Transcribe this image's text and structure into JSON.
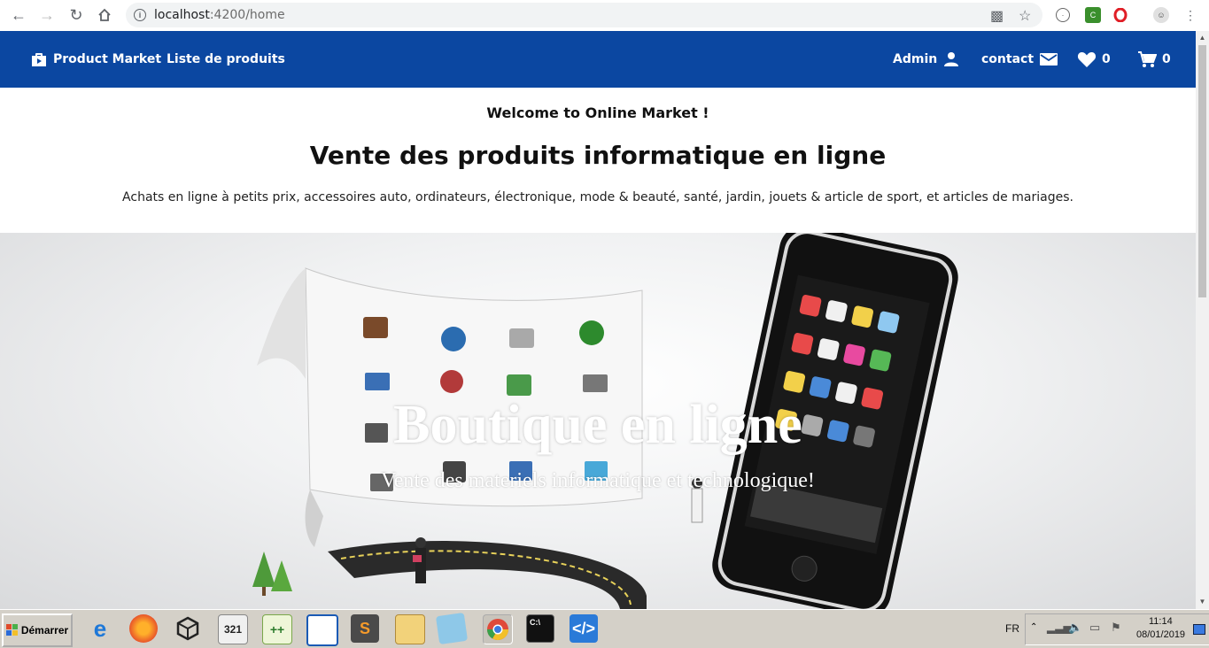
{
  "browser": {
    "url_host": "localhost",
    "url_rest": ":4200/home"
  },
  "nav": {
    "brand": "Product Market",
    "list_link": "Liste de produits",
    "admin": "Admin",
    "contact": "contact",
    "wishlist_count": "0",
    "cart_count": "0"
  },
  "page": {
    "welcome": "Welcome to Online Market !",
    "headline": "Vente des produits informatique en ligne",
    "description": "Achats en ligne à petits prix, accessoires auto, ordinateurs, électronique, mode & beauté, santé, jardin, jouets & article de sport, et articles de mariages."
  },
  "hero": {
    "title": "Boutique en ligne",
    "subtitle": "Vente des materiels informatique et technologique!"
  },
  "taskbar": {
    "start_label": "Démarrer",
    "language": "FR",
    "time": "11:14",
    "date": "08/01/2019"
  },
  "colors": {
    "appbar": "#0b47a1"
  }
}
